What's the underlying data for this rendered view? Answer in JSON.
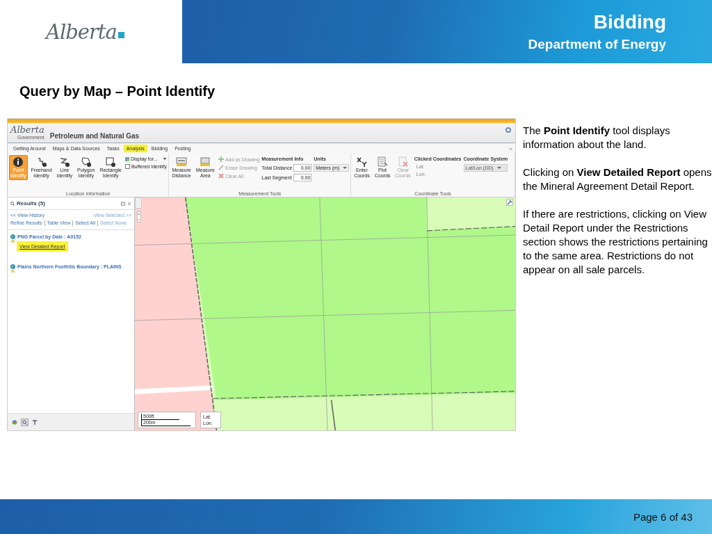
{
  "header": {
    "logo": "Alberta",
    "title": "Bidding",
    "subtitle": "Department of Energy"
  },
  "slide_title": "Query by Map – Point Identify",
  "app": {
    "logo": "Alberta",
    "logo_sub": "Government",
    "title": "Petroleum and Natural Gas",
    "tabs": [
      {
        "label": "Getting Around",
        "selected": false
      },
      {
        "label": "Maps & Data Sources",
        "selected": false
      },
      {
        "label": "Tasks",
        "selected": false
      },
      {
        "label": "Analysis",
        "selected": true
      },
      {
        "label": "Bidding",
        "selected": false
      },
      {
        "label": "Posting",
        "selected": false
      }
    ],
    "ribbon_groups": [
      {
        "label": "Location Information",
        "items": [
          {
            "kind": "big",
            "label": "Point Identify",
            "selected": true
          },
          {
            "kind": "big",
            "label": "Freehand Identify",
            "selected": false
          },
          {
            "kind": "big",
            "label": "Line Identify",
            "selected": false
          },
          {
            "kind": "big",
            "label": "Polygon Identify",
            "selected": false
          },
          {
            "kind": "big",
            "label": "Rectangle Identify",
            "selected": false
          },
          {
            "kind": "options",
            "dropdown": "Display for...",
            "checkbox": "Buffered Identify",
            "checked": false
          }
        ]
      },
      {
        "label": "Measurement Tools",
        "items": [
          {
            "kind": "big",
            "label": "Measure Distance",
            "selected": false
          },
          {
            "kind": "big",
            "label": "Measure Area",
            "selected": false
          },
          {
            "kind": "actions",
            "actions": [
              {
                "label": "Add as Drawing",
                "disabled": true
              },
              {
                "label": "Erase Drawing",
                "disabled": true
              },
              {
                "label": "Clear All",
                "disabled": true
              }
            ]
          },
          {
            "kind": "readouts",
            "heading": "Measurement Info",
            "rows": [
              {
                "label": "Total Distance",
                "value": "0.00"
              },
              {
                "label": "Last Segment",
                "value": "0.00"
              }
            ]
          },
          {
            "kind": "select",
            "heading": "Units",
            "value": "Meters (m)",
            "disabled": false
          }
        ]
      },
      {
        "label": "Coordinate Tools",
        "items": [
          {
            "kind": "big",
            "label": "Enter Coords",
            "selected": false
          },
          {
            "kind": "big",
            "label": "Plot Coords",
            "selected": false
          },
          {
            "kind": "big",
            "label": "Clear Coords",
            "selected": false,
            "disabled": true
          },
          {
            "kind": "coords",
            "heading": "Clicked Coordinates",
            "labels": [
              "Lat:",
              "Lon:"
            ]
          },
          {
            "kind": "select",
            "heading": "Coordinate System",
            "value": "Lat/Lon (DD)",
            "disabled": true
          }
        ]
      }
    ],
    "results": {
      "title": "Results (5)",
      "history": "<< View History",
      "view_selected": "View Selected >>",
      "actions": [
        {
          "label": "Refine Results",
          "disabled": false
        },
        {
          "label": "Table View",
          "disabled": false
        },
        {
          "label": "Select All",
          "disabled": false
        },
        {
          "label": "Select None",
          "disabled": true
        }
      ],
      "items": [
        {
          "title": "PNG Parcel by Date : A0152",
          "link": "View Detailed Report"
        },
        {
          "title": "Plains Northern Foothills Boundary : PLAINS"
        }
      ]
    },
    "map": {
      "kind": "picture",
      "scale_top": "500ft",
      "scale_bottom": "200m",
      "coord_labels": [
        "Lat:",
        "Lon:"
      ]
    }
  },
  "notes": [
    "The **Point Identify** tool displays information about the land.",
    "Clicking on **View Detailed Report** opens the Mineral Agreement Detail Report.",
    "If there are restrictions, clicking on View Detail Report under the Restrictions section shows the restrictions pertaining to the same area. Restrictions do not appear on all sale parcels."
  ],
  "footer": {
    "page": "Page 6 of 43"
  }
}
